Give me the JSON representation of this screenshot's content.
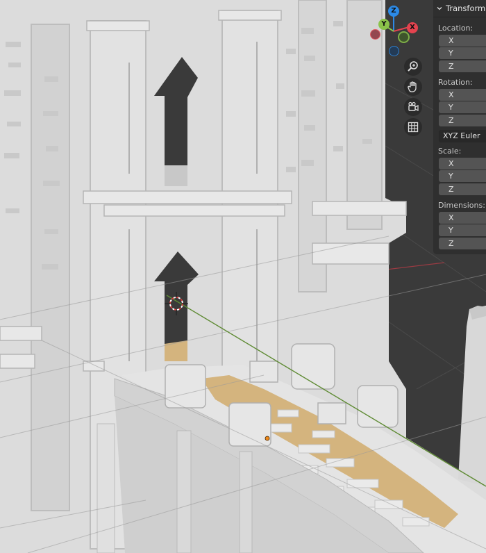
{
  "app": "3D Viewport",
  "gizmo": {
    "z_label": "Z",
    "y_label": "Y",
    "x_label": "X",
    "colors": {
      "x": "#e4434f",
      "y": "#8bc34a",
      "z": "#2c8ae6"
    }
  },
  "nav_tools": [
    {
      "icon": "zoom-icon"
    },
    {
      "icon": "hand-pan-icon"
    },
    {
      "icon": "camera-view-icon"
    },
    {
      "icon": "ortho-grid-icon"
    }
  ],
  "transform_panel": {
    "title": "Transform",
    "location": {
      "label": "Location:",
      "x": "X",
      "y": "Y",
      "z": "Z"
    },
    "rotation": {
      "label": "Rotation:",
      "x": "X",
      "y": "Y",
      "z": "Z"
    },
    "rotation_mode": "XYZ Euler",
    "scale": {
      "label": "Scale:",
      "x": "X",
      "y": "Y",
      "z": "Z"
    },
    "dimensions": {
      "label": "Dimensions:",
      "x": "X",
      "y": "Y",
      "z": "Z"
    }
  },
  "colors": {
    "background": "#3a3a3a",
    "model": "#dcdcdc",
    "sand": "#d4b47e",
    "panel": "#2f2f2f",
    "field": "#545454"
  }
}
